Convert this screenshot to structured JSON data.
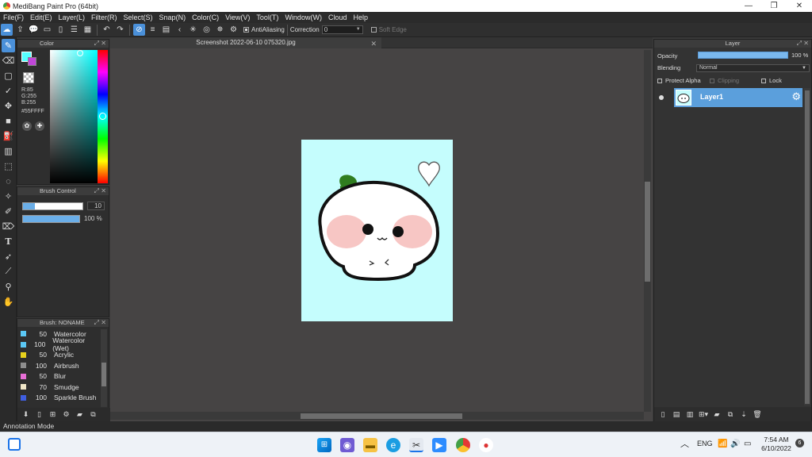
{
  "window": {
    "title": "MediBang Paint Pro (64bit)",
    "minimize": "—",
    "maximize": "❐",
    "close": "✕"
  },
  "menu": [
    "File(F)",
    "Edit(E)",
    "Layer(L)",
    "Filter(R)",
    "Select(S)",
    "Snap(N)",
    "Color(C)",
    "View(V)",
    "Tool(T)",
    "Window(W)",
    "Cloud",
    "Help"
  ],
  "toolbar": {
    "antialiasing_label": "AntiAliasing",
    "correction_label": "Correction",
    "correction_value": "0",
    "soft_edge_label": "Soft Edge",
    "antialiasing_checked": true,
    "soft_edge_checked": false
  },
  "color_panel": {
    "title": "Color",
    "r": "R:85",
    "g": "G:255",
    "b": "B:255",
    "hex": "#55FFFF",
    "foreground": "#55ffff",
    "background": "#c046d8"
  },
  "brush_control": {
    "title": "Brush Control",
    "size": "10",
    "opacity": "100 %",
    "size_fraction": 0.2,
    "opacity_fraction": 1.0
  },
  "brush_list": {
    "title": "Brush: NONAME",
    "items": [
      {
        "size": "50",
        "name": "Watercolor",
        "color": "#5bc8f5"
      },
      {
        "size": "100",
        "name": "Watercolor (Wet)",
        "color": "#5bc8f5"
      },
      {
        "size": "50",
        "name": "Acrylic",
        "color": "#e8d21d"
      },
      {
        "size": "100",
        "name": "Airbrush",
        "color": "#8e8e8e"
      },
      {
        "size": "50",
        "name": "Blur",
        "color": "#e86fd6"
      },
      {
        "size": "70",
        "name": "Smudge",
        "color": "#f0e6c8"
      },
      {
        "size": "100",
        "name": "Sparkle Brush",
        "color": "#3f5ee0"
      }
    ]
  },
  "document": {
    "tab_title": "Screenshot 2022-06-10 075320.jpg",
    "canvas_color": "#c5fdfd"
  },
  "layer_panel": {
    "title": "Layer",
    "opacity_label": "Opacity",
    "opacity_value": "100 %",
    "blending_label": "Blending",
    "blending_value": "Normal",
    "protect_alpha": "Protect Alpha",
    "clipping": "Clipping",
    "lock": "Lock",
    "layers": [
      {
        "name": "Layer1",
        "visible": true,
        "selected": true
      }
    ]
  },
  "status": {
    "mode": "Annotation Mode"
  },
  "taskbar": {
    "language": "ENG",
    "time": "7:54 AM",
    "date": "6/10/2022",
    "notifications": "6"
  }
}
